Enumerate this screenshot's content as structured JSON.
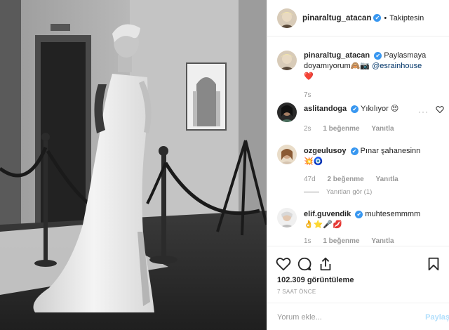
{
  "header": {
    "username": "pinaraltug_atacan",
    "follow_label": "Takiptesin",
    "separator": "•"
  },
  "caption": {
    "username": "pinaraltug_atacan",
    "text": "Paylasmaya doyamıyorum🙈📷",
    "mention": "@esrainhouse",
    "emoji_tail": "❤️",
    "time": "7s"
  },
  "comments": [
    {
      "username": "aslitandoga",
      "text": "Yıkılıyor 😍",
      "time": "2s",
      "likes": "1 beğenme",
      "reply": "Yanıtla"
    },
    {
      "username": "ozgeulusoy",
      "text": "Pınar şahanesinn",
      "text2": "💥🧿",
      "time": "47d",
      "likes": "2 beğenme",
      "reply": "Yanıtla",
      "view_replies": "Yanıtları gör (1)"
    },
    {
      "username": "elif.guvendik",
      "text": "muhtesemmmm",
      "text2": "👌⭐🎤💋",
      "time": "1s",
      "likes": "1 beğenme",
      "reply": "Yanıtla"
    }
  ],
  "actions": {
    "views": "102.309 görüntüleme",
    "ago": "7 SAAT ÖNCE",
    "icons": [
      "heart-icon",
      "comment-icon",
      "share-icon",
      "bookmark-icon"
    ]
  },
  "composer": {
    "placeholder": "Yorum ekle...",
    "post_label": "Paylaş"
  },
  "colors": {
    "link": "#003569",
    "verified": "#3897f0",
    "like_red": "#ed4956",
    "muted": "#999999"
  }
}
